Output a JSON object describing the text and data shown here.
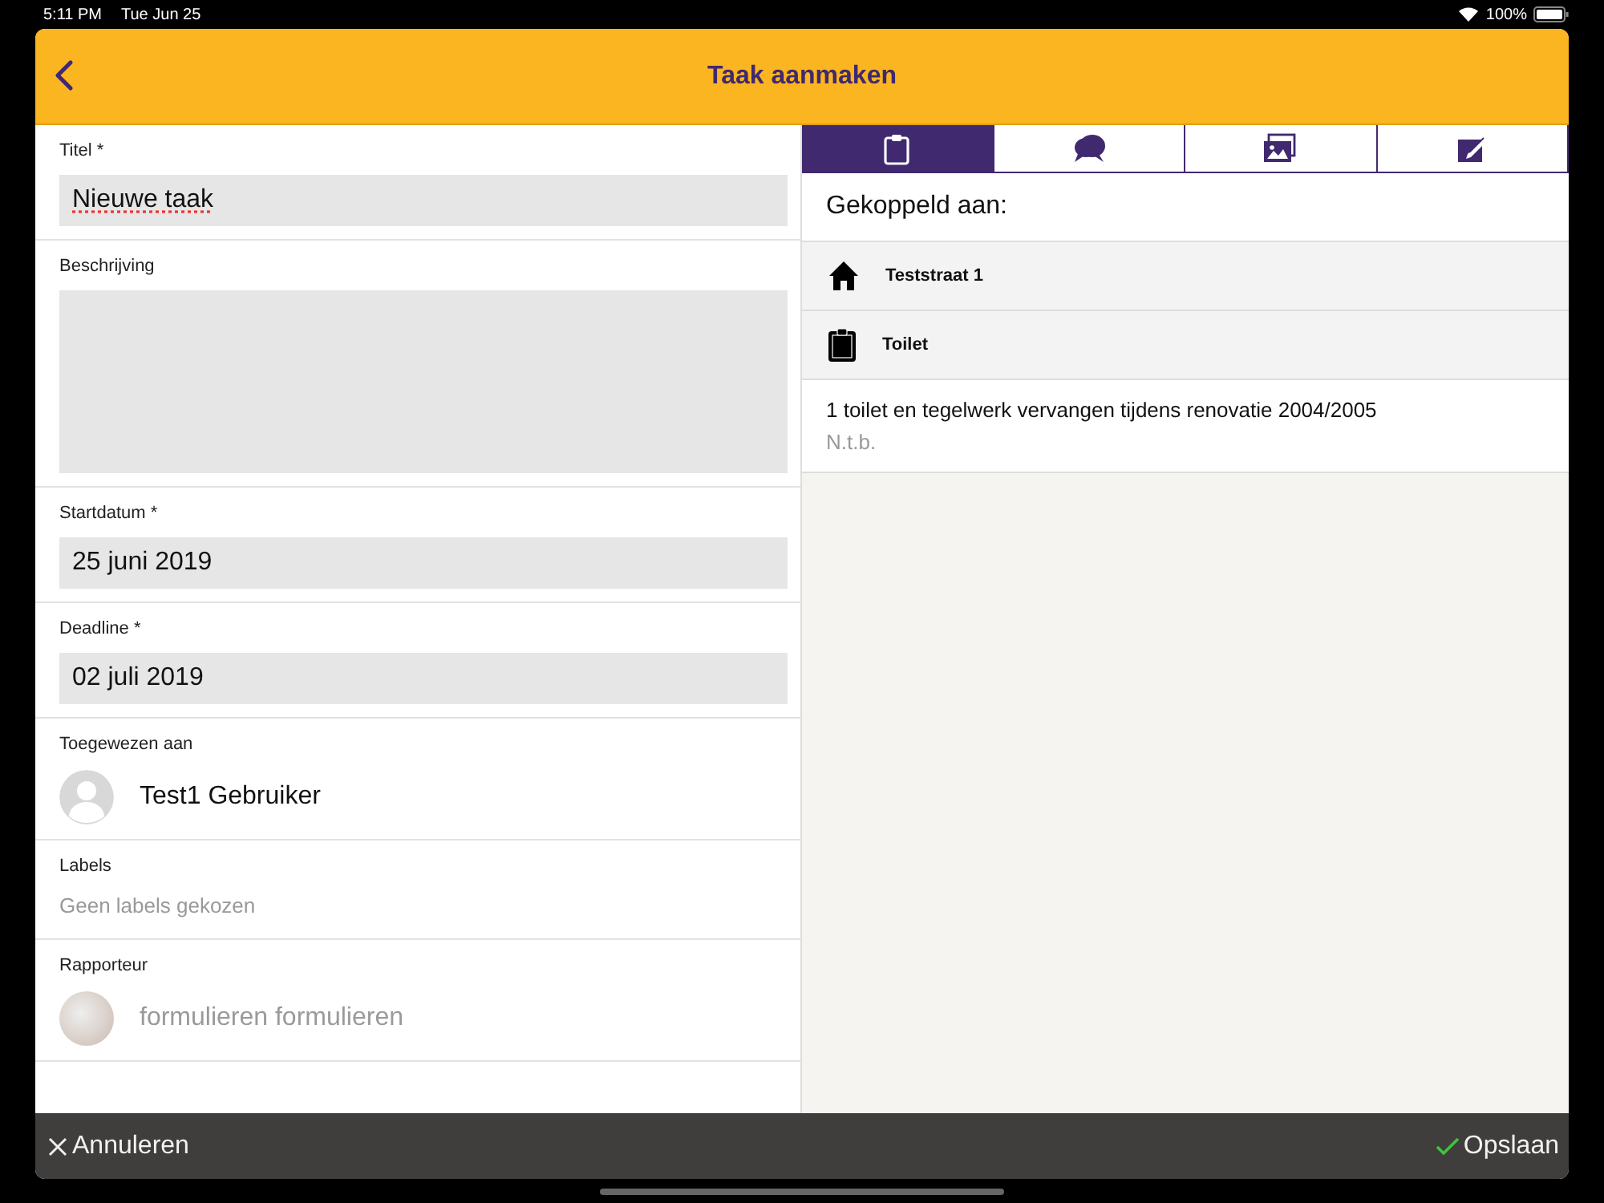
{
  "status_bar": {
    "time": "5:11 PM",
    "date": "Tue Jun 25",
    "battery": "100%"
  },
  "header": {
    "title": "Taak aanmaken"
  },
  "form": {
    "fields": [
      {
        "kind": "input",
        "label": "Titel *",
        "value": "Nieuwe taak",
        "misspelled": true
      },
      {
        "kind": "textarea",
        "label": "Beschrijving"
      },
      {
        "kind": "input",
        "label": "Startdatum *",
        "value": "25 juni 2019",
        "misspelled": false
      },
      {
        "kind": "input",
        "label": "Deadline *",
        "value": "02 juli 2019",
        "misspelled": false
      },
      {
        "kind": "person",
        "label": "Toegewezen aan",
        "name": "Test1 Gebruiker",
        "muted": false
      },
      {
        "kind": "hint",
        "label": "Labels",
        "placeholder": "Geen labels gekozen"
      },
      {
        "kind": "person_photo",
        "label": "Rapporteur",
        "name": "formulieren formulieren",
        "muted": true
      }
    ]
  },
  "tabs": [
    {
      "kind": "clipboard",
      "selected": true
    },
    {
      "kind": "chat",
      "selected": false
    },
    {
      "kind": "photos",
      "selected": false
    },
    {
      "kind": "edit",
      "selected": false
    }
  ],
  "linked": {
    "heading": "Gekoppeld aan:",
    "items": [
      {
        "kind": "address",
        "label": "Teststraat 1"
      },
      {
        "kind": "object",
        "label": "Toilet"
      }
    ],
    "description": "1 toilet en tegelwerk vervangen tijdens renovatie 2004/2005",
    "note": "N.t.b."
  },
  "actions": {
    "cancel": "Annuleren",
    "save": "Opslaan"
  }
}
